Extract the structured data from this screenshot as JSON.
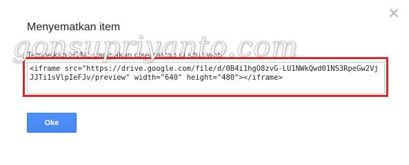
{
  "dialog": {
    "title": "Menyematkan item",
    "field_label": "Tempelkan HTML yang akan disematkan di situs web:",
    "embed_code": "<iframe src=\"https://drive.google.com/file/d/0B4i1hgO8zvG-LU1NWkQwd01NS3RpeGw2VjJJTi1sVlpIeFJv/preview\" width=\"640\" height=\"480\"></iframe>",
    "ok_label": "Oke"
  },
  "watermark": {
    "text": "gonsupriyanto.com"
  },
  "colors": {
    "highlight_border": "#d9262c",
    "button_blue": "#4d90fe",
    "close_icon": "#bdbdbd"
  },
  "icons": {
    "close": "close-icon"
  }
}
